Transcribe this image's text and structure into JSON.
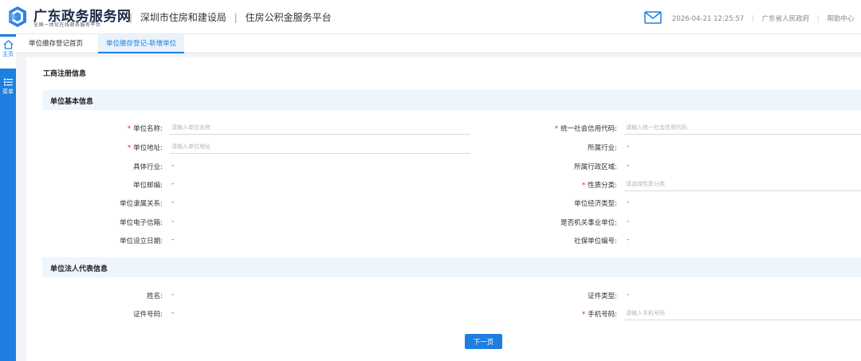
{
  "header": {
    "brand_title": "广东政务服务网",
    "brand_subtitle": "全国一体化在线政务服务平台",
    "dept": "深圳市住房和建设局",
    "platform": "住房公积金服务平台",
    "datetime": "2026-04-21 12:25:57",
    "region": "广东省人民政府",
    "help": "帮助中心",
    "sep": "|"
  },
  "sidebar": {
    "home": "主页",
    "menu": "菜单"
  },
  "tabs": [
    {
      "label": "单位缴存登记首页"
    },
    {
      "label": "单位缴存登记-新增单位"
    }
  ],
  "form": {
    "title": "工商注册信息",
    "sections": {
      "basic": "单位基本信息",
      "legal": "单位法人代表信息"
    },
    "required_mark": "*",
    "empty": "-",
    "fields": {
      "unit_name": {
        "label": "单位名称:",
        "placeholder": "请输入单位名称"
      },
      "credit_code": {
        "label": "统一社会信用代码:",
        "placeholder": "请输入统一社会信用代码"
      },
      "unit_address": {
        "label": "单位地址:",
        "placeholder": "请输入单位地址"
      },
      "industry": {
        "label": "所属行业:"
      },
      "specific_industry": {
        "label": "具体行业:"
      },
      "admin_region": {
        "label": "所属行政区域:"
      },
      "postcode": {
        "label": "单位邮编:"
      },
      "nature": {
        "label": "性质分类:",
        "placeholder": "请选择性质分类"
      },
      "affiliation": {
        "label": "单位隶属关系:"
      },
      "economic_type": {
        "label": "单位经济类型:"
      },
      "email": {
        "label": "单位电子信箱:"
      },
      "is_gov": {
        "label": "是否机关事业单位:"
      },
      "setup_date": {
        "label": "单位设立日期:"
      },
      "social_no": {
        "label": "社保单位编号:"
      },
      "name": {
        "label": "姓名:"
      },
      "id_type": {
        "label": "证件类型:"
      },
      "id_no": {
        "label": "证件号码:"
      },
      "mobile": {
        "label": "手机号码:",
        "placeholder": "请输入手机号码"
      }
    }
  },
  "next_button": "下一页",
  "colors": {
    "accent": "#1e7fe0",
    "required": "#e02020"
  }
}
